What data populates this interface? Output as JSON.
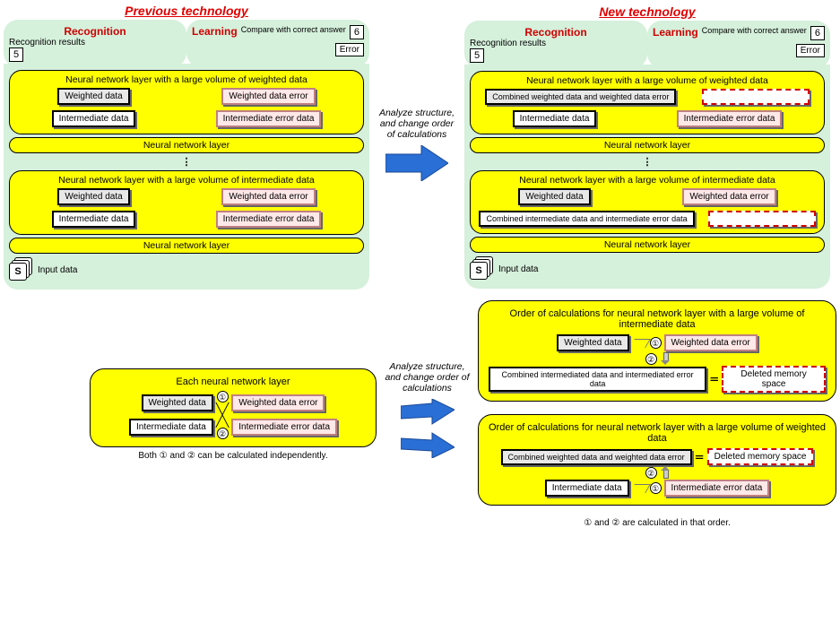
{
  "titles": {
    "previous": "Previous technology",
    "new": "New technology"
  },
  "headings": {
    "recognition": "Recognition",
    "learning": "Learning",
    "recog_results": "Recognition results",
    "compare": "Compare with correct answer"
  },
  "boxes": {
    "five": "5",
    "six": "6",
    "error": "Error"
  },
  "layers": {
    "weighted_vol": "Neural network layer with a large volume of weighted data",
    "intermediate_vol": "Neural network layer with a large volume of intermediate data",
    "plain": "Neural network layer"
  },
  "cells": {
    "weighted": "Weighted data",
    "weighted_err": "Weighted data error",
    "intermediate": "Intermediate data",
    "intermediate_err": "Intermediate error data",
    "combined_w": "Combined weighted data and weighted data error",
    "combined_i": "Combined intermediate data and intermediate error data",
    "combined_i2": "Combined intermediated data and intermediated error data",
    "deleted": "Deleted memory space"
  },
  "arrow_text": "Analyze structure, and change order of calculations",
  "input_data": "Input data",
  "input_glyph": "S",
  "bottom": {
    "each_title": "Each neural network layer",
    "order_inter": "Order of calculations for neural network layer with a large volume of intermediate data",
    "order_weight": "Order of calculations for neural network layer with a large volume of weighted data",
    "foot1": "Both ① and ② can be calculated independently.",
    "foot2": "① and ② are calculated in that order.",
    "one": "①",
    "two": "②"
  }
}
